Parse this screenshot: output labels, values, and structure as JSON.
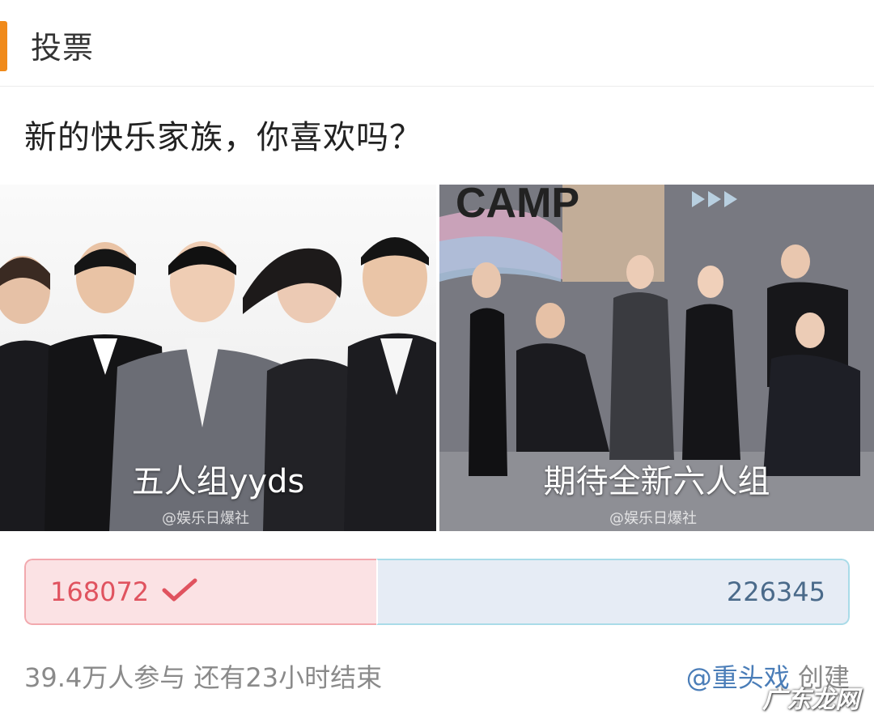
{
  "header": {
    "title": "投票"
  },
  "question": "新的快乐家族，你喜欢吗？",
  "options": [
    {
      "label": "五人组yyds",
      "watermark": "@娱乐日爆社",
      "votes": "168072",
      "selected": true
    },
    {
      "label": "期待全新六人组",
      "watermark": "@娱乐日爆社",
      "votes": "226345",
      "selected": false,
      "poster_text": "CAMP"
    }
  ],
  "result": {
    "left_share": 0.4262
  },
  "footer": {
    "stats": "39.4万人参与  还有23小时结束",
    "creator": "@重头戏",
    "creator_suffix": " 创建"
  },
  "site_watermark": "广东龙网",
  "colors": {
    "accent": "#f08a1a",
    "left_fill": "#fbe2e4",
    "left_text": "#e0535f",
    "right_fill": "#e6ecf5",
    "right_text": "#4a6a8a",
    "creator_link": "#4a7db8"
  },
  "icons": {
    "selected": "check-icon"
  }
}
